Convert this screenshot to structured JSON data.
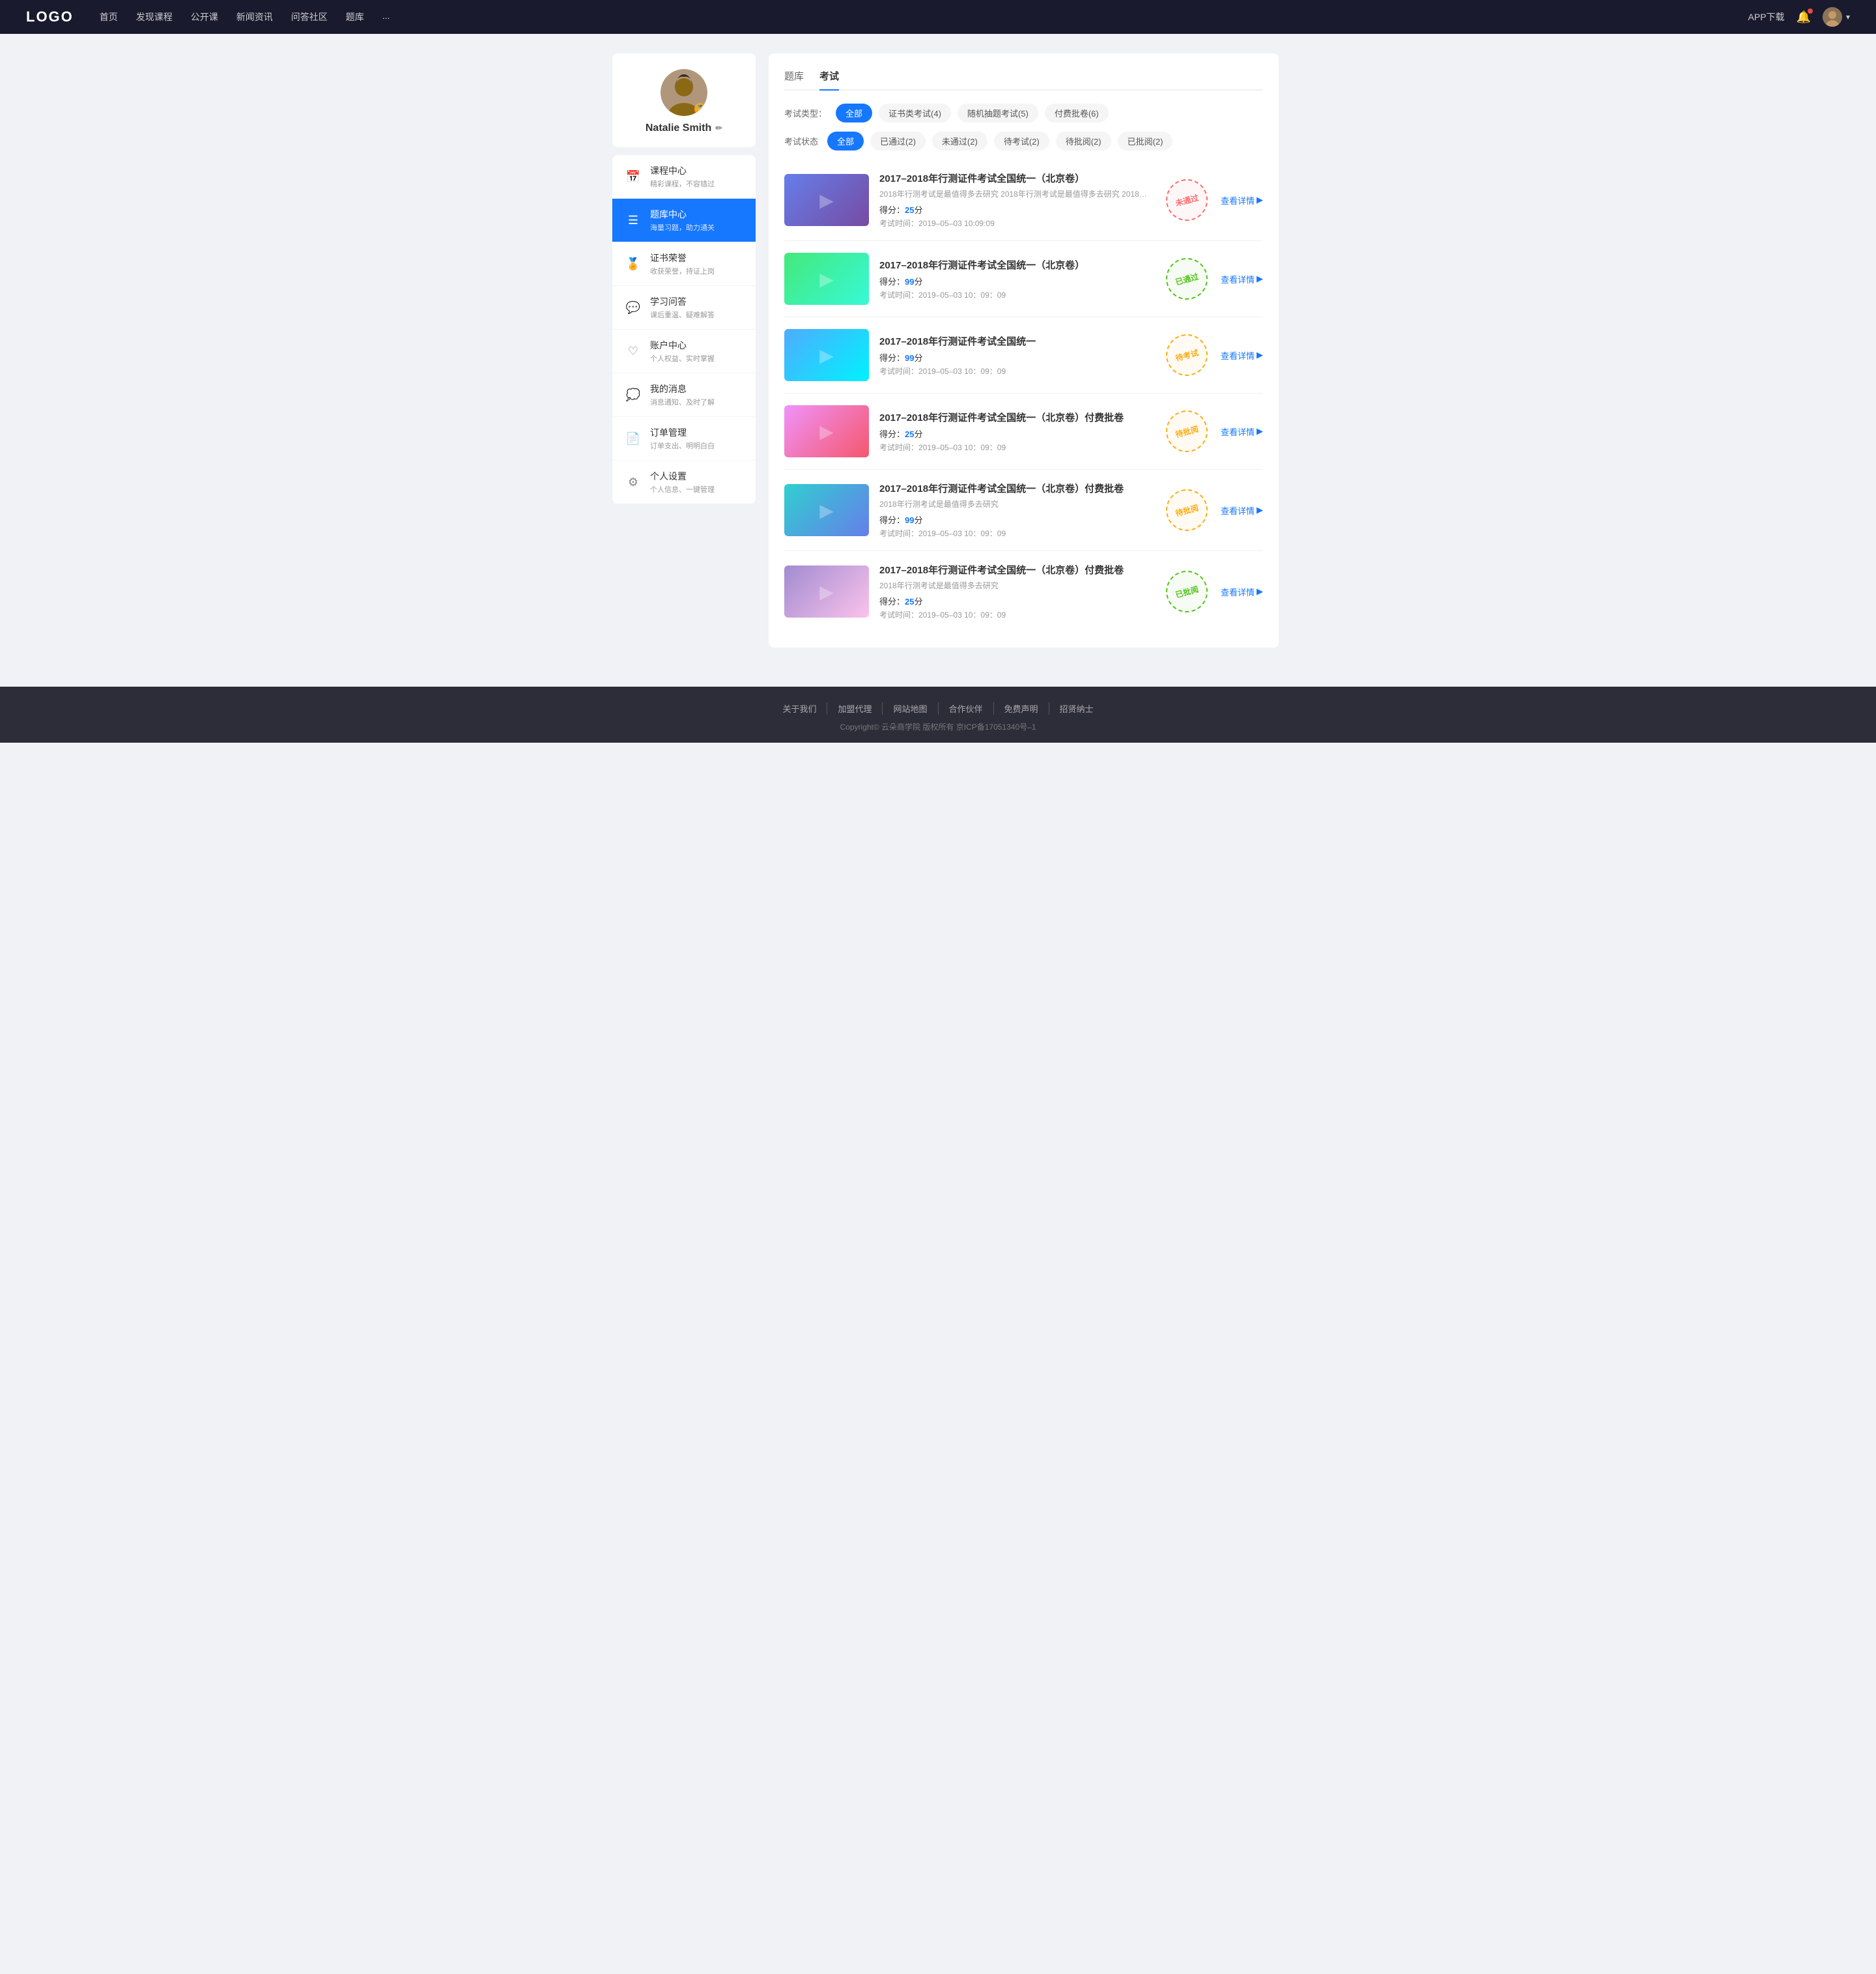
{
  "navbar": {
    "logo": "LOGO",
    "nav_items": [
      "首页",
      "发现课程",
      "公开课",
      "新闻资讯",
      "问答社区",
      "题库",
      "..."
    ],
    "app_download": "APP下载"
  },
  "sidebar": {
    "user": {
      "name": "Natalie Smith",
      "edit_icon": "✏"
    },
    "menu": [
      {
        "id": "course-center",
        "icon": "📅",
        "label": "课程中心",
        "sublabel": "精彩课程，不容错过",
        "active": false
      },
      {
        "id": "question-bank",
        "icon": "☰",
        "label": "题库中心",
        "sublabel": "海量习题，助力通关",
        "active": true
      },
      {
        "id": "certificate",
        "icon": "🏅",
        "label": "证书荣誉",
        "sublabel": "收获荣誉，持证上岗",
        "active": false
      },
      {
        "id": "qa",
        "icon": "💬",
        "label": "学习问答",
        "sublabel": "课后重温、疑难解答",
        "active": false
      },
      {
        "id": "account",
        "icon": "♡",
        "label": "账户中心",
        "sublabel": "个人权益、实时掌握",
        "active": false
      },
      {
        "id": "messages",
        "icon": "💭",
        "label": "我的消息",
        "sublabel": "消息通知、及时了解",
        "active": false
      },
      {
        "id": "orders",
        "icon": "📄",
        "label": "订单管理",
        "sublabel": "订单支出、明明白白",
        "active": false
      },
      {
        "id": "settings",
        "icon": "⚙",
        "label": "个人设置",
        "sublabel": "个人信息、一键管理",
        "active": false
      }
    ]
  },
  "main": {
    "tabs": [
      {
        "label": "题库",
        "active": false
      },
      {
        "label": "考试",
        "active": true
      }
    ],
    "type_filter": {
      "label": "考试类型：",
      "options": [
        {
          "label": "全部",
          "active": true
        },
        {
          "label": "证书类考试(4)",
          "active": false
        },
        {
          "label": "随机抽题考试(5)",
          "active": false
        },
        {
          "label": "付费批卷(6)",
          "active": false
        }
      ]
    },
    "status_filter": {
      "label": "考试状态",
      "options": [
        {
          "label": "全部",
          "active": true
        },
        {
          "label": "已通过(2)",
          "active": false
        },
        {
          "label": "未通过(2)",
          "active": false
        },
        {
          "label": "待考试(2)",
          "active": false
        },
        {
          "label": "待批阅(2)",
          "active": false
        },
        {
          "label": "已批阅(2)",
          "active": false
        }
      ]
    },
    "exams": [
      {
        "id": 1,
        "title": "2017–2018年行测证件考试全国统一（北京卷）",
        "desc": "2018年行测考试是最值得多去研究 2018年行测考试是最值得多去研究 2018年行…",
        "score_label": "得分：",
        "score": "25",
        "score_unit": "分",
        "time_label": "考试时间：",
        "time": "2019–05–03  10:09:09",
        "status": "未通过",
        "status_class": "not-pass",
        "thumb_class": "thumb-1",
        "view_label": "查看详情"
      },
      {
        "id": 2,
        "title": "2017–2018年行测证件考试全国统一（北京卷）",
        "desc": "",
        "score_label": "得分：",
        "score": "99",
        "score_unit": "分",
        "time_label": "考试时间：",
        "time": "2019–05–03  10：09：09",
        "status": "已通过",
        "status_class": "passed",
        "thumb_class": "thumb-2",
        "view_label": "查看详情"
      },
      {
        "id": 3,
        "title": "2017–2018年行测证件考试全国统一",
        "desc": "",
        "score_label": "得分：",
        "score": "99",
        "score_unit": "分",
        "time_label": "考试时间：",
        "time": "2019–05–03  10：09：09",
        "status": "待考试",
        "status_class": "pending",
        "thumb_class": "thumb-3",
        "view_label": "查看详情"
      },
      {
        "id": 4,
        "title": "2017–2018年行测证件考试全国统一（北京卷）付费批卷",
        "desc": "",
        "score_label": "得分：",
        "score": "25",
        "score_unit": "分",
        "time_label": "考试时间：",
        "time": "2019–05–03  10：09：09",
        "status": "待批阅",
        "status_class": "pending",
        "thumb_class": "thumb-4",
        "view_label": "查看详情"
      },
      {
        "id": 5,
        "title": "2017–2018年行测证件考试全国统一（北京卷）付费批卷",
        "desc": "2018年行测考试是最值得多去研究",
        "score_label": "得分：",
        "score": "99",
        "score_unit": "分",
        "time_label": "考试时间：",
        "time": "2019–05–03  10：09：09",
        "status": "待批阅",
        "status_class": "pending",
        "thumb_class": "thumb-5",
        "view_label": "查看详情"
      },
      {
        "id": 6,
        "title": "2017–2018年行测证件考试全国统一（北京卷）付费批卷",
        "desc": "2018年行测考试是最值得多去研究",
        "score_label": "得分：",
        "score": "25",
        "score_unit": "分",
        "time_label": "考试时间：",
        "time": "2019–05–03  10：09：09",
        "status": "已批阅",
        "status_class": "reviewed",
        "thumb_class": "thumb-6",
        "view_label": "查看详情"
      }
    ]
  },
  "footer": {
    "links": [
      "关于我们",
      "加盟代理",
      "网站地图",
      "合作伙伴",
      "免费声明",
      "招贤纳士"
    ],
    "copyright": "Copyright© 云朵商学院  版权所有    京ICP备17051340号–1"
  }
}
